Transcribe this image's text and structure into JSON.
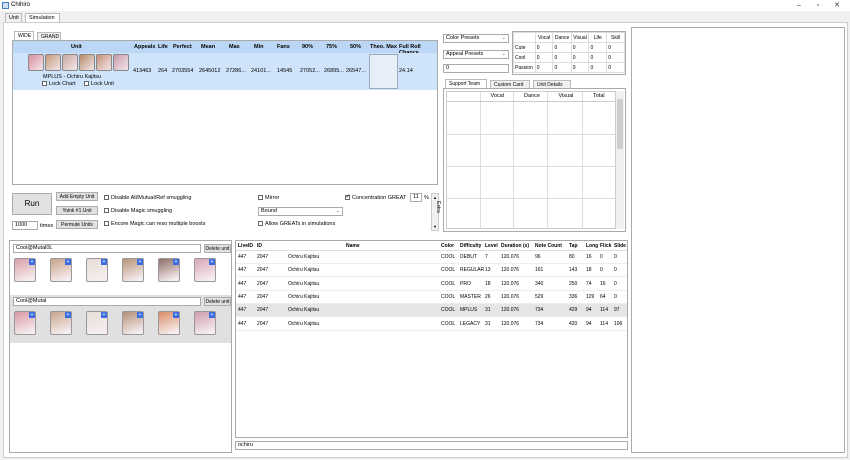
{
  "window": {
    "title": "Chihiro"
  },
  "main_tabs": [
    "Unit",
    "Simulation"
  ],
  "sub_tabs": [
    "WIDE",
    "GRAND"
  ],
  "unit_table": {
    "headers": [
      "Unit",
      "Appeals",
      "Life",
      "Perfect",
      "Mean",
      "Max",
      "Min",
      "Fans",
      "90%",
      "75%",
      "50%",
      "Theo. Max",
      "Full Roll Chance"
    ],
    "row": {
      "unit_name": "MPLUS - Ochiru Kajitsu",
      "appeals": "413463",
      "life": "264",
      "perfect": "2703554",
      "mean": "2645012",
      "max": "27286...",
      "min": "24101...",
      "fans": "14545",
      "p90": "27052...",
      "p75": "26895...",
      "p50": "26547...",
      "theo": "",
      "full_roll": "24.14",
      "lock_chart": "Lock Chart",
      "lock_unit": "Lock Unit"
    }
  },
  "controls": {
    "run": "Run",
    "add_empty": "Add Empty Unit",
    "yoink": "Yoink #1 Unit",
    "permute": "Permute Units",
    "times_value": "1000",
    "times_label": "times",
    "disable_smuggling": "Disable All/Mutual/Ref smuggling",
    "disable_magic": "Disable Magic smuggling",
    "encore": "Encore Magic can reso multiple boosts",
    "mirror": "Mirror",
    "bound": "Bound",
    "allow_greats": "Allow GREATs in simulations",
    "concentration": "Concentration GREAT",
    "concentration_value": "11",
    "percent": "%",
    "extra": "Extra"
  },
  "presets": {
    "color": "Color Presets",
    "appeal": "Appeal Presets",
    "value": "0"
  },
  "stats": {
    "headers": [
      "",
      "Vocal",
      "Dance",
      "Visual",
      "Life",
      "Skill"
    ],
    "rows": [
      [
        "Cute",
        "0",
        "0",
        "0",
        "0",
        "0"
      ],
      [
        "Cool",
        "0",
        "0",
        "0",
        "0",
        "0"
      ],
      [
        "Passion",
        "0",
        "0",
        "0",
        "0",
        "0"
      ]
    ]
  },
  "right_tabs": [
    "Support Team",
    "Custom Card",
    "Unit Details"
  ],
  "support": {
    "headers": [
      "",
      "Vocal",
      "Dance",
      "Visual",
      "Total"
    ]
  },
  "units": [
    {
      "name": "Cool@Mutal0L",
      "delete": "Delete unit"
    },
    {
      "name": "Cool@Mutal",
      "delete": "Delete unit"
    }
  ],
  "songs": {
    "headers": [
      "LiveID",
      "ID",
      "Name",
      "Color",
      "Difficulty",
      "Level",
      "Duration (s)",
      "Note Count",
      "Tap",
      "Long",
      "Flick",
      "Slide"
    ],
    "rows": [
      [
        "447",
        "2047",
        "Ochiru Kajitsu",
        "COOL",
        "DEBUT",
        "7",
        "120.076",
        "96",
        "80",
        "16",
        "0",
        "0"
      ],
      [
        "447",
        "2047",
        "Ochiru Kajitsu",
        "COOL",
        "REGULAR",
        "13",
        "120.076",
        "161",
        "143",
        "18",
        "0",
        "0"
      ],
      [
        "447",
        "2047",
        "Ochiru Kajitsu",
        "COOL",
        "PRO",
        "18",
        "120.076",
        "340",
        "250",
        "74",
        "16",
        "0"
      ],
      [
        "447",
        "2047",
        "Ochiru Kajitsu",
        "COOL",
        "MASTER",
        "26",
        "120.076",
        "529",
        "336",
        "129",
        "64",
        "0"
      ],
      [
        "447",
        "2047",
        "Ochiru Kajitsu",
        "COOL",
        "MPLUS",
        "31",
        "120.076",
        "734",
        "429",
        "94",
        "114",
        "97"
      ],
      [
        "447",
        "2047",
        "Ochiru Kajitsu",
        "COOL",
        "LEGACY",
        "31",
        "120.076",
        "734",
        "420",
        "94",
        "114",
        "106"
      ]
    ],
    "search": "ochiru"
  },
  "colors": {
    "accent": "#cfe3fb",
    "header": "#bcd6f5",
    "cool": "#3d6ee0"
  }
}
